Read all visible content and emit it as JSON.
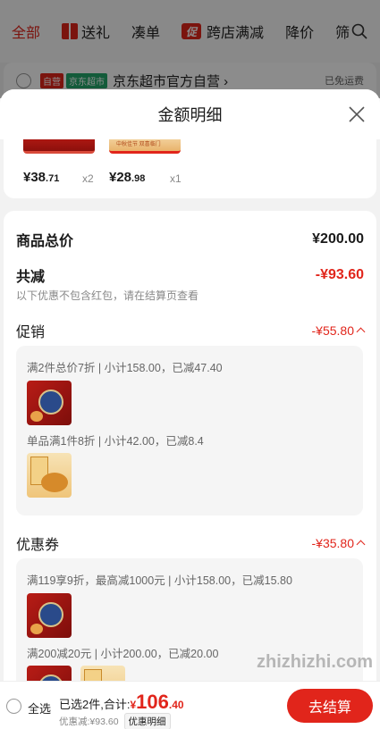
{
  "top_tabs": {
    "all": "全部",
    "gift": "送礼",
    "combine": "凑单",
    "cross_store": "跨店满减",
    "price_drop": "降价",
    "more": "筛"
  },
  "store": {
    "self_tag": "自营",
    "super_tag": "京东超市",
    "name": "京东超市官方自营 ›",
    "freight": "已免运费"
  },
  "sheet": {
    "title": "金额明细"
  },
  "items": [
    {
      "price_int": "¥38",
      "price_dec": ".71",
      "qty": "x2"
    },
    {
      "price_int": "¥28",
      "price_dec": ".98",
      "qty": "x1"
    }
  ],
  "thumb_b_text": "中秋佳节 双喜临门",
  "detail": {
    "total_label": "商品总价",
    "total_value": "¥200.00",
    "discount_label": "共减",
    "discount_value": "-¥93.60",
    "note": "以下优惠不包含红包，请在结算页查看",
    "promo": {
      "label": "促销",
      "value": "-¥55.80",
      "line1": "满2件总价7折 | 小计158.00，已减47.40",
      "line2": "单品满1件8折 | 小计42.00，已减8.4"
    },
    "coupon": {
      "label": "优惠券",
      "value": "-¥35.80",
      "line1": "满119享9折，最高减1000元 | 小计158.00，已减15.80",
      "line2": "满200减20元 | 小计200.00，已减20.00"
    }
  },
  "bottom": {
    "select_all": "全选",
    "selected_text": "已选2件,合计:",
    "currency": "¥",
    "total_int": "106",
    "total_dec": ".40",
    "discount_text": "优惠减:¥93.60",
    "detail_button": "优惠明细",
    "checkout": "去结算"
  },
  "watermark": "zhizhizhi.com",
  "colors": {
    "accent": "#e1251b",
    "green": "#23a76a"
  }
}
